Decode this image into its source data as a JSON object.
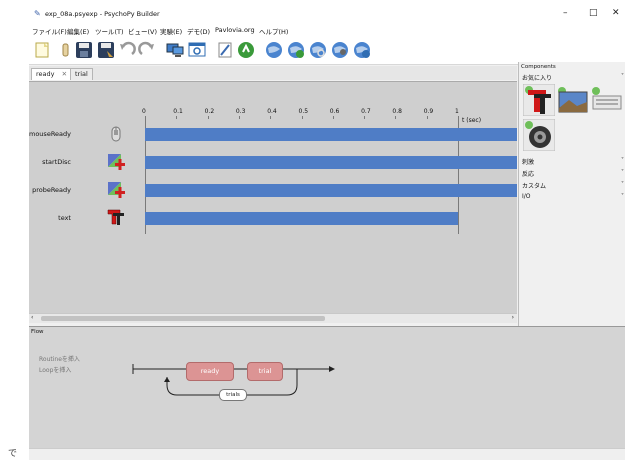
{
  "window": {
    "title": "exp_08a.psyexp - PsychoPy Builder",
    "controls": [
      "–",
      "□",
      "✕"
    ]
  },
  "menu": [
    "ファイル(F)",
    "編集(E)",
    "ツール(T)",
    "ビュー(V)",
    "実験(E)",
    "デモ(D)",
    "Pavlovia.org",
    "ヘルプ(H)"
  ],
  "toolbar": {
    "icons": [
      "new-file-icon",
      "open-icon",
      "save-icon",
      "save-as-icon",
      "undo-icon",
      "redo-icon",
      "monitor-icon",
      "experiment-settings-icon",
      "compile-script-icon",
      "run-icon",
      "globe-icon",
      "globe-sync-icon",
      "globe-search-icon",
      "globe-user-icon",
      "globe-info-icon"
    ]
  },
  "tabs": [
    {
      "label": "ready",
      "close": "✕",
      "active": true
    },
    {
      "label": "trial",
      "active": false
    }
  ],
  "timeline": {
    "ticks": [
      "0",
      "0.1",
      "0.2",
      "0.3",
      "0.4",
      "0.5",
      "0.6",
      "0.7",
      "0.8",
      "0.9",
      "1"
    ],
    "unit": "t (sec)",
    "components": [
      {
        "name": "mouseReady",
        "icon": "mouse-icon",
        "start": 0,
        "end": null
      },
      {
        "name": "startDisc",
        "icon": "polygon-icon",
        "start": 0,
        "end": null
      },
      {
        "name": "probeReady",
        "icon": "polygon-icon",
        "start": 0,
        "end": null
      },
      {
        "name": "text",
        "icon": "text-icon",
        "start": 0,
        "end": 1.0
      }
    ]
  },
  "components_panel": {
    "title": "Components",
    "favorites_label": "お気に入り",
    "favorites": [
      "text-component-icon",
      "image-component-icon",
      "keyboard-component-icon",
      "sound-component-icon"
    ],
    "categories": [
      "刺激",
      "反応",
      "カスタム",
      "I/O"
    ]
  },
  "flow": {
    "title": "Flow",
    "insert_routine": "Routineを挿入",
    "insert_loop": "Loopを挿入",
    "routines": [
      "ready",
      "trial"
    ],
    "loop": "trials"
  },
  "colors": {
    "bar": "#4f7dc6",
    "routine": "#dc9494",
    "canvas": "#cfcfcf"
  },
  "side_glyph": "で"
}
